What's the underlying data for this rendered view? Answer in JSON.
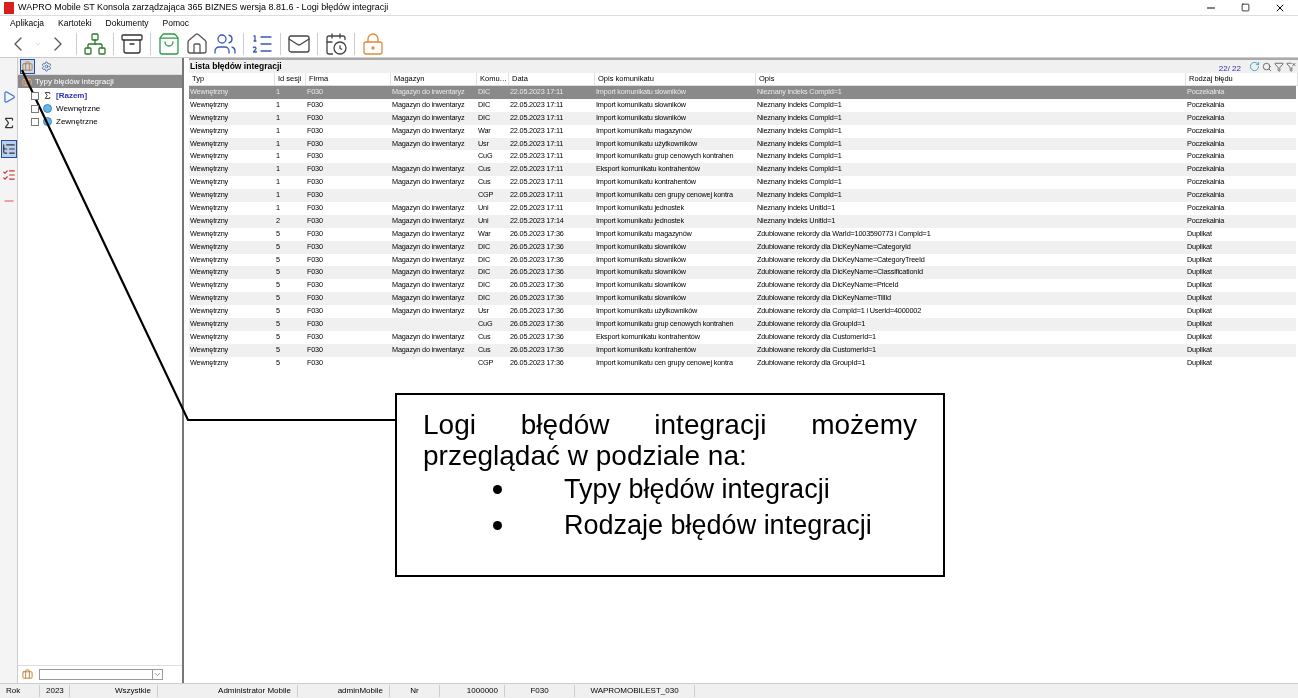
{
  "window": {
    "title": "WAPRO Mobile ST Konsola zarządzająca 365 BIZNES wersja 8.81.6 - Logi błędów integracji"
  },
  "menu": [
    "Aplikacja",
    "Kartoteki",
    "Dokumenty",
    "Pomoc"
  ],
  "left_panel": {
    "header": "Typy błędów integracji",
    "view_buttons": [
      {
        "selected": true
      },
      {
        "selected": false
      }
    ],
    "side_tools": [
      {
        "kind": "play",
        "selected": false
      },
      {
        "kind": "sum",
        "selected": false
      },
      {
        "kind": "tree",
        "selected": true
      },
      {
        "kind": "check",
        "selected": false
      },
      {
        "kind": "dash",
        "selected": false
      }
    ],
    "items": [
      {
        "label": "[Razem]",
        "kind": "sum",
        "checked": false
      },
      {
        "label": "Wewnętrzne",
        "kind": "circle",
        "checked": false
      },
      {
        "label": "Zewnętrzne",
        "kind": "circle",
        "checked": false
      }
    ]
  },
  "table": {
    "title": "Lista błędów integracji",
    "count": "22/ 22",
    "columns": [
      "Typ",
      "Id sesji",
      "Firma",
      "Magazyn",
      "Komu…",
      "Data",
      "Opis komunikatu",
      "Opis",
      "Rodzaj błędu"
    ],
    "rows": [
      {
        "selected": true,
        "cells": [
          "Wewnętrzny",
          "1",
          "F030",
          "Magazyn do inwentaryz",
          "DIC",
          "22.05.2023 17:11",
          "Import komunikatu słowników",
          "Nieznany indeks CompId=1",
          "Poczekalnia"
        ]
      },
      {
        "selected": false,
        "cells": [
          "Wewnętrzny",
          "1",
          "F030",
          "Magazyn do inwentaryz",
          "DIC",
          "22.05.2023 17:11",
          "Import komunikatu słowników",
          "Nieznany indeks CompId=1",
          "Poczekalnia"
        ]
      },
      {
        "selected": false,
        "cells": [
          "Wewnętrzny",
          "1",
          "F030",
          "Magazyn do inwentaryz",
          "DIC",
          "22.05.2023 17:11",
          "Import komunikatu słowników",
          "Nieznany indeks CompId=1",
          "Poczekalnia"
        ]
      },
      {
        "selected": false,
        "cells": [
          "Wewnętrzny",
          "1",
          "F030",
          "Magazyn do inwentaryz",
          "War",
          "22.05.2023 17:11",
          "Import komunikatu magazynów",
          "Nieznany indeks CompId=1",
          "Poczekalnia"
        ]
      },
      {
        "selected": false,
        "cells": [
          "Wewnętrzny",
          "1",
          "F030",
          "Magazyn do inwentaryz",
          "Usr",
          "22.05.2023 17:11",
          "Import komunikatu użytkowników",
          "Nieznany indeks CompId=1",
          "Poczekalnia"
        ]
      },
      {
        "selected": false,
        "cells": [
          "Wewnętrzny",
          "1",
          "F030",
          "",
          "CuG",
          "22.05.2023 17:11",
          "Import komunikatu grup cenowych kontrahen",
          "Nieznany indeks CompId=1",
          "Poczekalnia"
        ]
      },
      {
        "selected": false,
        "cells": [
          "Wewnętrzny",
          "1",
          "F030",
          "Magazyn do inwentaryz",
          "Cus",
          "22.05.2023 17:11",
          "Eksport komunikatu kontrahentów",
          "Nieznany indeks CompId=1",
          "Poczekalnia"
        ]
      },
      {
        "selected": false,
        "cells": [
          "Wewnętrzny",
          "1",
          "F030",
          "Magazyn do inwentaryz",
          "Cus",
          "22.05.2023 17:11",
          "Import komunikatu kontrahentów",
          "Nieznany indeks CompId=1",
          "Poczekalnia"
        ]
      },
      {
        "selected": false,
        "cells": [
          "Wewnętrzny",
          "1",
          "F030",
          "",
          "CGP",
          "22.05.2023 17:11",
          "Import komunikatu cen grupy cenowej kontra",
          "Nieznany indeks CompId=1",
          "Poczekalnia"
        ]
      },
      {
        "selected": false,
        "cells": [
          "Wewnętrzny",
          "1",
          "F030",
          "Magazyn do inwentaryz",
          "Uni",
          "22.05.2023 17:11",
          "Import komunikatu jednostek",
          "Nieznany indeks UnitId=1",
          "Poczekalnia"
        ]
      },
      {
        "selected": false,
        "cells": [
          "Wewnętrzny",
          "2",
          "F030",
          "Magazyn do inwentaryz",
          "Uni",
          "22.05.2023 17:14",
          "Import komunikatu jednostek",
          "Nieznany indeks UnitId=1",
          "Poczekalnia"
        ]
      },
      {
        "selected": false,
        "cells": [
          "Wewnętrzny",
          "5",
          "F030",
          "Magazyn do inwentaryz",
          "War",
          "26.05.2023 17:36",
          "Import komunikatu magazynów",
          "Zdublowane rekordy dla WarId=1003590773 i CompId=1",
          "Duplikat"
        ]
      },
      {
        "selected": false,
        "cells": [
          "Wewnętrzny",
          "5",
          "F030",
          "Magazyn do inwentaryz",
          "DIC",
          "26.05.2023 17:36",
          "Import komunikatu słowników",
          "Zdublowane rekordy dla DicKeyName=CategoryId",
          "Duplikat"
        ]
      },
      {
        "selected": false,
        "cells": [
          "Wewnętrzny",
          "5",
          "F030",
          "Magazyn do inwentaryz",
          "DIC",
          "26.05.2023 17:36",
          "Import komunikatu słowników",
          "Zdublowane rekordy dla DicKeyName=CategoryTreeId",
          "Duplikat"
        ]
      },
      {
        "selected": false,
        "cells": [
          "Wewnętrzny",
          "5",
          "F030",
          "Magazyn do inwentaryz",
          "DIC",
          "26.05.2023 17:36",
          "Import komunikatu słowników",
          "Zdublowane rekordy dla DicKeyName=ClassificationId",
          "Duplikat"
        ]
      },
      {
        "selected": false,
        "cells": [
          "Wewnętrzny",
          "5",
          "F030",
          "Magazyn do inwentaryz",
          "DIC",
          "26.05.2023 17:36",
          "Import komunikatu słowników",
          "Zdublowane rekordy dla DicKeyName=PriceId",
          "Duplikat"
        ]
      },
      {
        "selected": false,
        "cells": [
          "Wewnętrzny",
          "5",
          "F030",
          "Magazyn do inwentaryz",
          "DIC",
          "26.05.2023 17:36",
          "Import komunikatu słowników",
          "Zdublowane rekordy dla DicKeyName=TillId",
          "Duplikat"
        ]
      },
      {
        "selected": false,
        "cells": [
          "Wewnętrzny",
          "5",
          "F030",
          "Magazyn do inwentaryz",
          "Usr",
          "26.05.2023 17:36",
          "Import komunikatu użytkowników",
          "Zdublowane rekordy dla CompId=1 i UserId=4000002",
          "Duplikat"
        ]
      },
      {
        "selected": false,
        "cells": [
          "Wewnętrzny",
          "5",
          "F030",
          "",
          "CuG",
          "26.05.2023 17:36",
          "Import komunikatu grup cenowych kontrahen",
          "Zdublowane rekordy dla GroupId=1",
          "Duplikat"
        ]
      },
      {
        "selected": false,
        "cells": [
          "Wewnętrzny",
          "5",
          "F030",
          "Magazyn do inwentaryz",
          "Cus",
          "26.05.2023 17:36",
          "Eksport komunikatu kontrahentów",
          "Zdublowane rekordy dla CustomerId=1",
          "Duplikat"
        ]
      },
      {
        "selected": false,
        "cells": [
          "Wewnętrzny",
          "5",
          "F030",
          "Magazyn do inwentaryz",
          "Cus",
          "26.05.2023 17:36",
          "Import komunikatu kontrahentów",
          "Zdublowane rekordy dla CustomerId=1",
          "Duplikat"
        ]
      },
      {
        "selected": false,
        "cells": [
          "Wewnętrzny",
          "5",
          "F030",
          "",
          "CGP",
          "26.05.2023 17:36",
          "Import komunikatu cen grupy cenowej kontra",
          "Zdublowane rekordy dla GroupId=1",
          "Duplikat"
        ]
      }
    ]
  },
  "status_bar": [
    "Rok",
    "2023",
    "Wszystkie",
    "Administrator Mobile",
    "adminMobile",
    "Nr",
    "1000000",
    "F030",
    "WAPROMOBILEST_030"
  ],
  "callout": {
    "text": "Logi błędów integracji możemy przeglądać w podziale na:",
    "bullets": [
      "Typy błędów integracji",
      "Rodzaje błędów integracji"
    ]
  }
}
